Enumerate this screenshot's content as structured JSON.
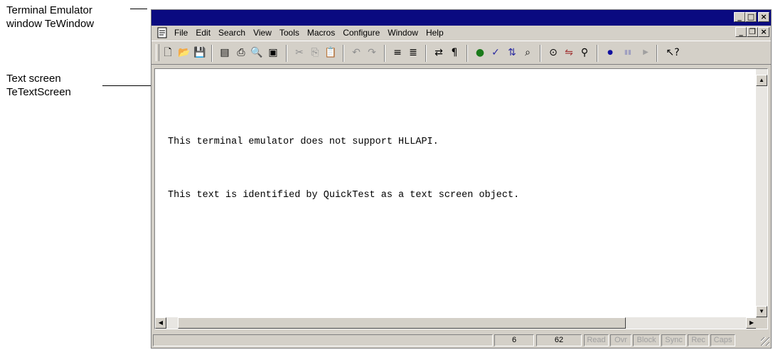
{
  "annotations": {
    "window_label_line1": "Terminal Emulator",
    "window_label_line2": "window TeWindow",
    "screen_label_line1": "Text screen",
    "screen_label_line2": "TeTextScreen"
  },
  "caption_buttons": [
    "minimize-glyph",
    "restore-glyph",
    "close-glyph"
  ],
  "menu": {
    "items": [
      "File",
      "Edit",
      "Search",
      "View",
      "Tools",
      "Macros",
      "Configure",
      "Window",
      "Help"
    ]
  },
  "toolbar_icons": [
    "new-icon",
    "open-icon",
    "save-icon",
    "properties-icon",
    "print-icon",
    "print-preview-icon",
    "capture-icon",
    "cut-icon",
    "copy-icon",
    "paste-icon",
    "undo-icon",
    "redo-icon",
    "align-left-icon",
    "align-right-icon",
    "wrap-icon",
    "paragraph-icon",
    "globe-icon",
    "spellcheck-icon",
    "sort-icon",
    "find-record-icon",
    "zoom-icon",
    "replace-icon",
    "binoculars-icon",
    "record-icon",
    "pause-icon",
    "play-icon",
    "help-pointer-icon"
  ],
  "screen": {
    "line1": "This terminal emulator does not support HLLAPI.",
    "line2": "This text is identified by QuickTest as a text screen object."
  },
  "status": {
    "row": "6",
    "col": "62",
    "indicators": [
      "Read",
      "Ovr",
      "Block",
      "Sync",
      "Rec",
      "Caps"
    ]
  },
  "colors": {
    "titlebar": "#0a0a80",
    "chrome": "#d4d0c8"
  }
}
